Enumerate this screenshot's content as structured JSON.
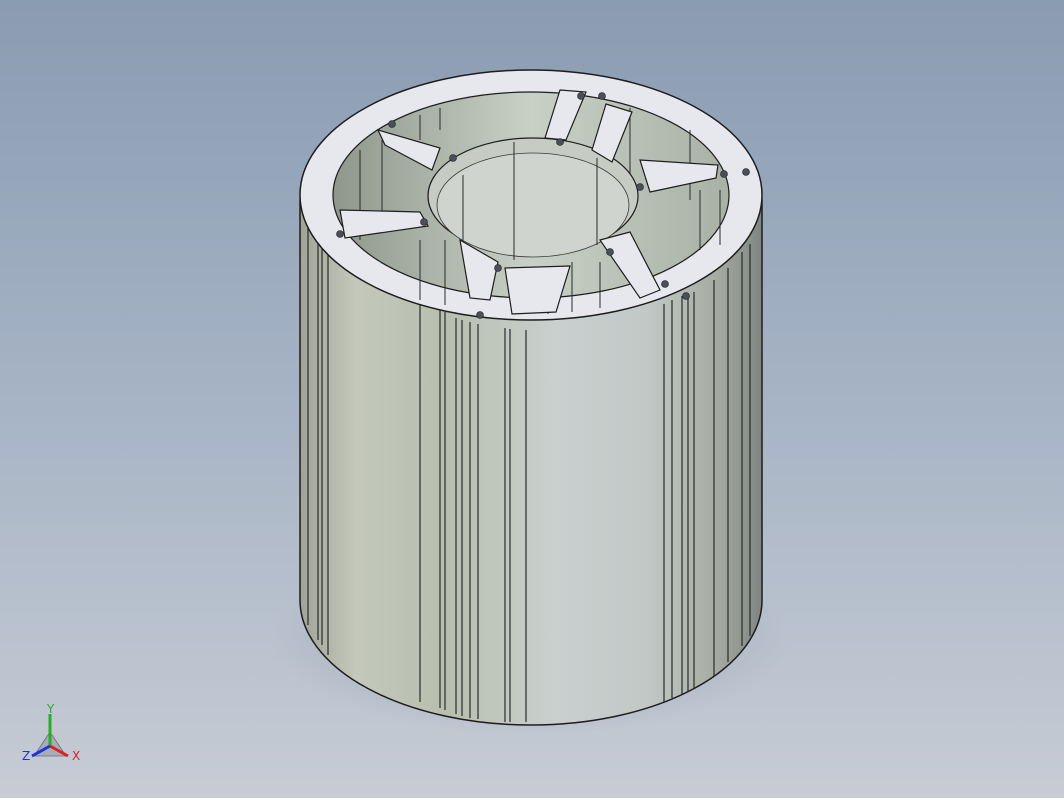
{
  "viewport": {
    "background_top": "#8a9cb2",
    "background_bottom": "#c7ccd5",
    "model": "extruded-aluminum-cylinder-profile"
  },
  "triad": {
    "x_label": "X",
    "y_label": "Y",
    "z_label": "Z",
    "x_color": "#e02020",
    "y_color": "#22b022",
    "z_color": "#2030e0"
  }
}
